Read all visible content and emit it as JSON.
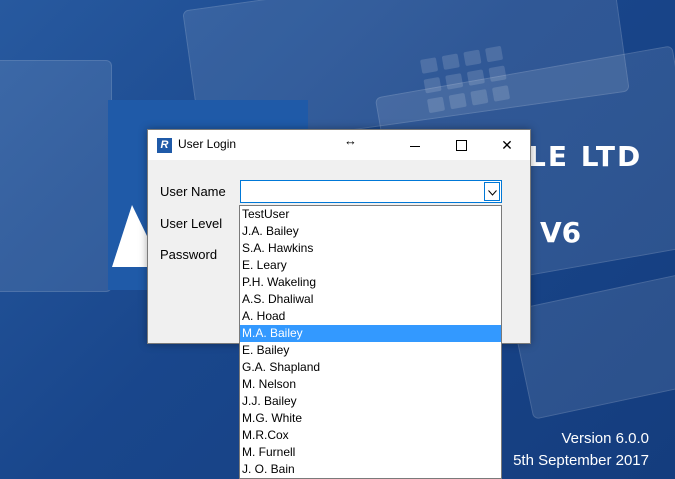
{
  "background": {
    "company_text": "LE LTD",
    "version_tag": "V6",
    "version_text": "Version 6.0.0",
    "date_text": "5th September 2017"
  },
  "dialog": {
    "title": "User Login",
    "resize_glyph": "↔",
    "close_glyph": "✕",
    "labels": {
      "user_name": "User Name",
      "user_level": "User Level",
      "password": "Password"
    },
    "user_name_value": ""
  },
  "dropdown": {
    "items": [
      "TestUser",
      "J.A. Bailey",
      "S.A. Hawkins",
      "E. Leary",
      "P.H. Wakeling",
      "A.S. Dhaliwal",
      "A. Hoad",
      "M.A. Bailey",
      "E. Bailey",
      "G.A. Shapland",
      "M. Nelson",
      "J.J. Bailey",
      "M.G. White",
      "M.R.Cox",
      "M. Furnell",
      "J. O. Bain"
    ],
    "highlighted_index": 7
  },
  "colors": {
    "accent": "#0078d7",
    "highlight": "#3399ff",
    "brand": "#1f5aa8"
  }
}
